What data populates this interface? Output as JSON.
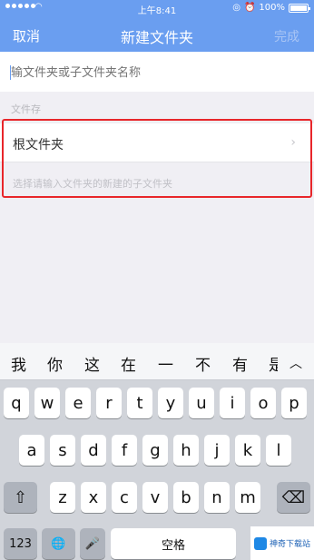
{
  "status": {
    "time": "上午8:41",
    "battery": "100%"
  },
  "nav": {
    "cancel": "取消",
    "title": "新建文件夹",
    "done": "完成"
  },
  "form": {
    "name_placeholder": "输文件夹或子文件夹名称",
    "section_label": "文件存",
    "folder": "根文件夹",
    "hint": "选择请输入文件夹的新建的子文件夹"
  },
  "keyboard": {
    "candidates": [
      "我",
      "你",
      "这",
      "在",
      "一",
      "不",
      "有",
      "是"
    ],
    "collapse": "︿",
    "row1": [
      "q",
      "w",
      "e",
      "r",
      "t",
      "y",
      "u",
      "i",
      "o",
      "p"
    ],
    "row2": [
      "a",
      "s",
      "d",
      "f",
      "g",
      "h",
      "j",
      "k",
      "l"
    ],
    "row3": [
      "z",
      "x",
      "c",
      "v",
      "b",
      "n",
      "m"
    ],
    "shift": "⇧",
    "delete": "⌫",
    "num": "123",
    "globe": "🌐",
    "mic": "🎤",
    "space": "空格"
  },
  "watermark": "神奇下载站",
  "colors": {
    "accent": "#6a9ef0",
    "highlight": "#e8262a"
  }
}
